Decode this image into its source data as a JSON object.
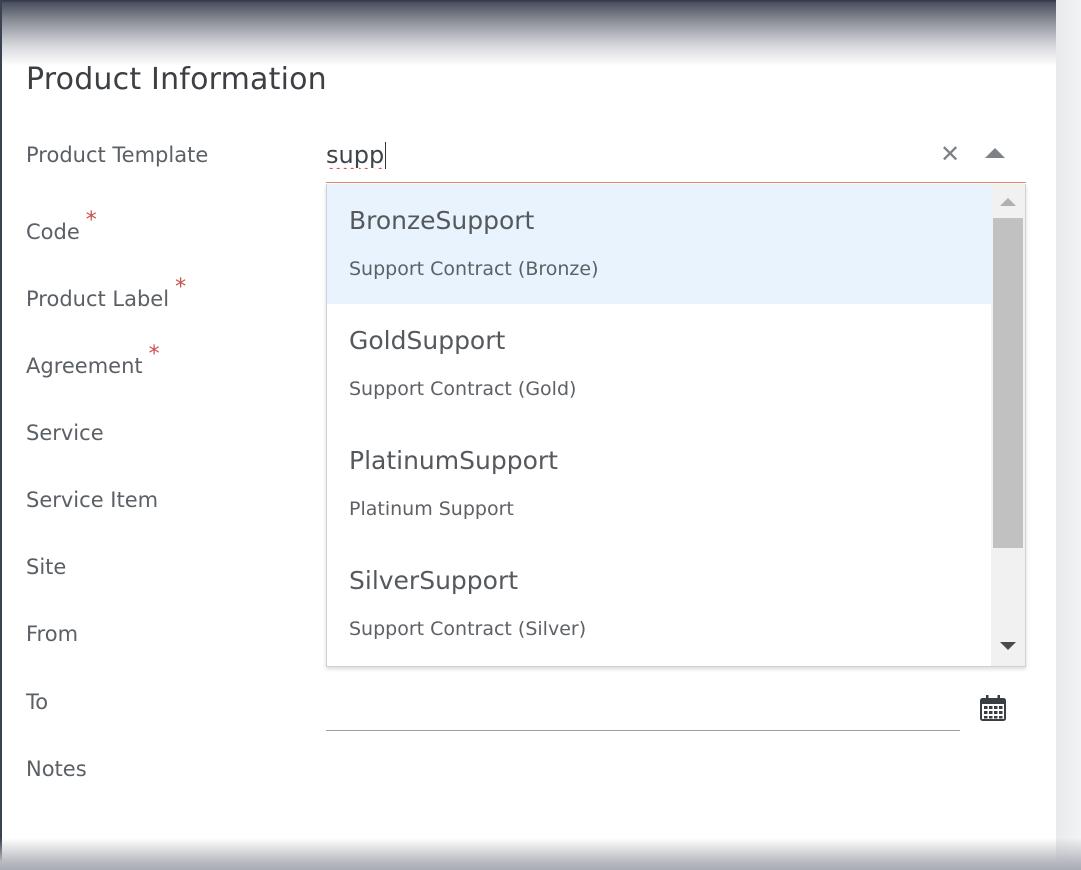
{
  "section": {
    "title": "Product Information"
  },
  "form": {
    "labels": {
      "product_template": "Product Template",
      "code": "Code",
      "product_label": "Product Label",
      "agreement": "Agreement",
      "service": "Service",
      "service_item": "Service Item",
      "site": "Site",
      "from": "From",
      "to": "To",
      "notes": "Notes"
    },
    "required_marker": "*"
  },
  "product_template": {
    "value": "supp",
    "clear_icon": "close-icon",
    "toggle_icon": "caret-up-icon"
  },
  "dropdown": {
    "options": [
      {
        "code": "BronzeSupport",
        "description": "Support Contract (Bronze)"
      },
      {
        "code": "GoldSupport",
        "description": "Support Contract (Gold)"
      },
      {
        "code": "PlatinumSupport",
        "description": "Platinum Support"
      },
      {
        "code": "SilverSupport",
        "description": "Support Contract (Silver)"
      }
    ],
    "highlighted_index": 0
  },
  "to_field": {
    "value": "",
    "icon": "calendar-icon"
  },
  "colors": {
    "required": "#c8504c",
    "highlight": "#e8f3fd",
    "input_underline_active": "#e38a6f",
    "text": "#555a5f"
  }
}
